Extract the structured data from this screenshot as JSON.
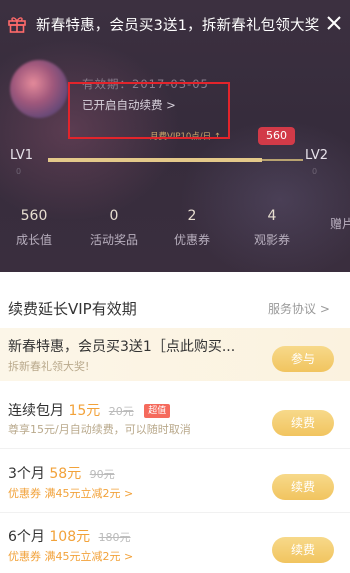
{
  "promo_bar": {
    "text": "新春特惠，会员买3送1，拆新春礼包领大奖",
    "gift_icon": "gift-icon",
    "close_icon": "close-icon"
  },
  "profile": {
    "expiry": "有效期：2017-03-05",
    "auto_renew": "已开启自动续费 >",
    "points_text": "月费VIP10点/日 ↑",
    "points_badge": "560"
  },
  "level": {
    "left": "LV1",
    "right": "LV2",
    "left_sub": "0",
    "right_sub": "0",
    "progress_fraction": 0.84
  },
  "stats": [
    {
      "value": "560",
      "label": "成长值"
    },
    {
      "value": "0",
      "label": "活动奖品"
    },
    {
      "value": "2",
      "label": "优惠券"
    },
    {
      "value": "4",
      "label": "观影券"
    },
    {
      "value": "",
      "label": "赠片"
    }
  ],
  "section": {
    "title": "续费延长VIP有效期",
    "link": "服务协议 >"
  },
  "offers": [
    {
      "name": "新春特惠，会员买3送1［点此购买...",
      "desc": "拆新春礼领大奖!",
      "button": "参与"
    },
    {
      "name": "连续包月",
      "price": "15元",
      "original": "20元",
      "tag": "超值",
      "desc": "尊享15元/月自动续费，可以随时取消",
      "button": "续费"
    },
    {
      "name": "3个月",
      "price": "58元",
      "original": "90元",
      "desc": "优惠券 满45元立减2元 >",
      "button": "续费"
    },
    {
      "name": "6个月",
      "price": "108元",
      "original": "180元",
      "desc": "优惠券 满45元立减2元 >",
      "button": "续费"
    }
  ],
  "colors": {
    "header_bg": "#3a2e3e",
    "gold": "#f1c45f",
    "accent_orange": "#f2a23a",
    "highlight_red": "#e3242b"
  }
}
